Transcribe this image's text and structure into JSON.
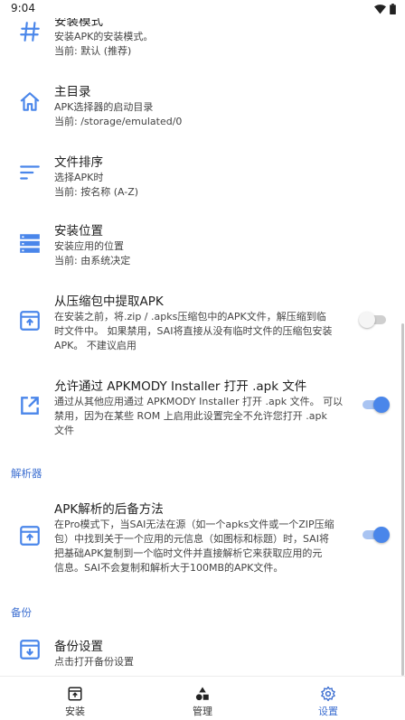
{
  "status_bar": {
    "time": "9:04"
  },
  "colors": {
    "accent": "#4a86ea",
    "section_header": "#3d6fd1"
  },
  "preferences": [
    {
      "title": "安装模式",
      "lines": [
        "安装APK的安装模式。",
        "当前: 默认 (推荐)"
      ],
      "icon": "hash-icon"
    },
    {
      "title": "主目录",
      "lines": [
        "APK选择器的启动目录",
        "当前: /storage/emulated/0"
      ],
      "icon": "home-icon"
    },
    {
      "title": "文件排序",
      "lines": [
        "选择APK时",
        "当前: 按名称 (A-Z)"
      ],
      "icon": "sort-icon"
    },
    {
      "title": "安装位置",
      "lines": [
        "安装应用的位置",
        "当前: 由系统决定"
      ],
      "icon": "storage-icon"
    },
    {
      "title": "从压缩包中提取APK",
      "lines": [
        "在安装之前，将.zip / .apks压缩包中的APK文件，解压缩到临",
        "时文件中。 如果禁用，SAI将直接从没有临时文件的压缩包安装",
        "APK。 不建议启用"
      ],
      "icon": "archive-upload-icon",
      "switch_on": false
    },
    {
      "title": "允许通过 APKMODY Installer 打开 .apk 文件",
      "lines": [
        "通过从其他应用通过 APKMODY Installer 打开 .apk 文件。 可以",
        "禁用，因为在某些 ROM 上启用此设置完全不允许您打开 .apk",
        "文件"
      ],
      "icon": "open-external-icon",
      "switch_on": true
    },
    {
      "title": "APK解析的后备方法",
      "lines": [
        "在Pro模式下，当SAI无法在源（如一个apks文件或一个ZIP压缩",
        "包）中找到关于一个应用的元信息（如图标和标题）时，SAI将",
        "把基础APK复制到一个临时文件并直接解析它来获取应用的元",
        "信息。SAI不会复制和解析大于100MB的APK文件。"
      ],
      "icon": "archive-upload-icon",
      "switch_on": true
    },
    {
      "title": "备份设置",
      "lines": [
        "点击打开备份设置"
      ],
      "icon": "archive-download-icon"
    }
  ],
  "sections": {
    "parser": "解析器",
    "backup": "备份"
  },
  "bottom_nav": [
    {
      "label": "安装",
      "icon": "install-icon",
      "active": false
    },
    {
      "label": "管理",
      "icon": "shapes-icon",
      "active": false
    },
    {
      "label": "设置",
      "icon": "gear-icon",
      "active": true
    }
  ]
}
